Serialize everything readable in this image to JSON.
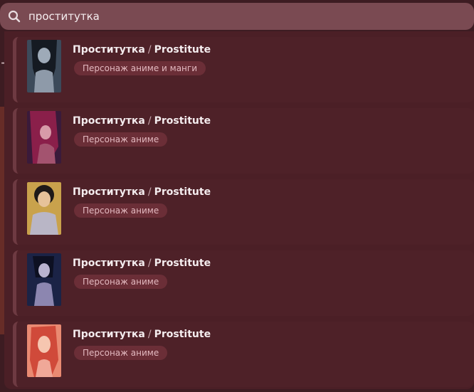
{
  "search": {
    "query": "проститутка",
    "placeholder": ""
  },
  "results": [
    {
      "title_ru": "Проститутка",
      "title_en": "Prostitute",
      "separator": "/",
      "badge": "Персонаж аниме и манги",
      "thumb_icon": "character-portrait-dark-hair"
    },
    {
      "title_ru": "Проститутка",
      "title_en": "Prostitute",
      "separator": "/",
      "badge": "Персонаж аниме",
      "thumb_icon": "character-portrait-red-hair"
    },
    {
      "title_ru": "Проститутка",
      "title_en": "Prostitute",
      "separator": "/",
      "badge": "Персонаж аниме",
      "thumb_icon": "character-portrait-curly-hair"
    },
    {
      "title_ru": "Проститутка",
      "title_en": "Prostitute",
      "separator": "/",
      "badge": "Персонаж аниме",
      "thumb_icon": "character-portrait-night"
    },
    {
      "title_ru": "Проститутка",
      "title_en": "Prostitute",
      "separator": "/",
      "badge": "Персонаж аниме",
      "thumb_icon": "character-portrait-orange-hair"
    }
  ],
  "colors": {
    "search_bar": "#7a4a52",
    "panel": "#4b1f26",
    "badge_bg": "#6b2e37",
    "badge_text": "#e3b9c0"
  }
}
